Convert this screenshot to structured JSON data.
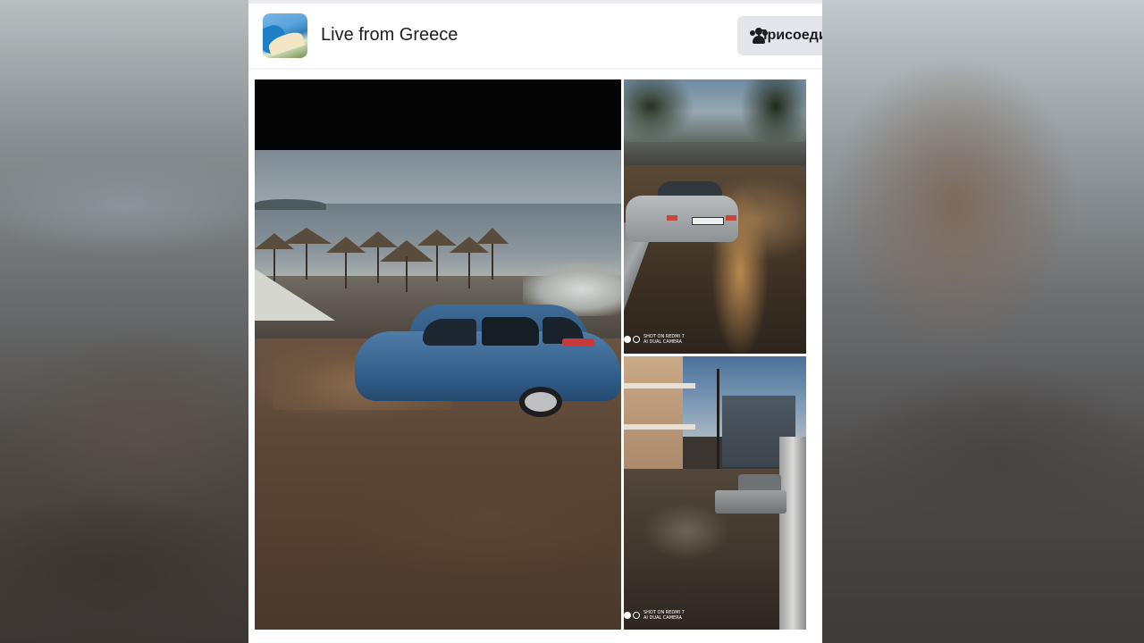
{
  "page": {
    "name": "Live from Greece",
    "join_button_label": "Присоединиться"
  },
  "photos": {
    "camera_watermark_line1": "SHOT ON REDMI 7",
    "camera_watermark_line2": "AI DUAL CAMERA"
  },
  "icons": {
    "avatar": "beach-coast-avatar",
    "join": "group-icon"
  },
  "colors": {
    "card_background": "#ffffff",
    "button_background": "#e4e6eb",
    "text_primary": "#1c1e21"
  }
}
